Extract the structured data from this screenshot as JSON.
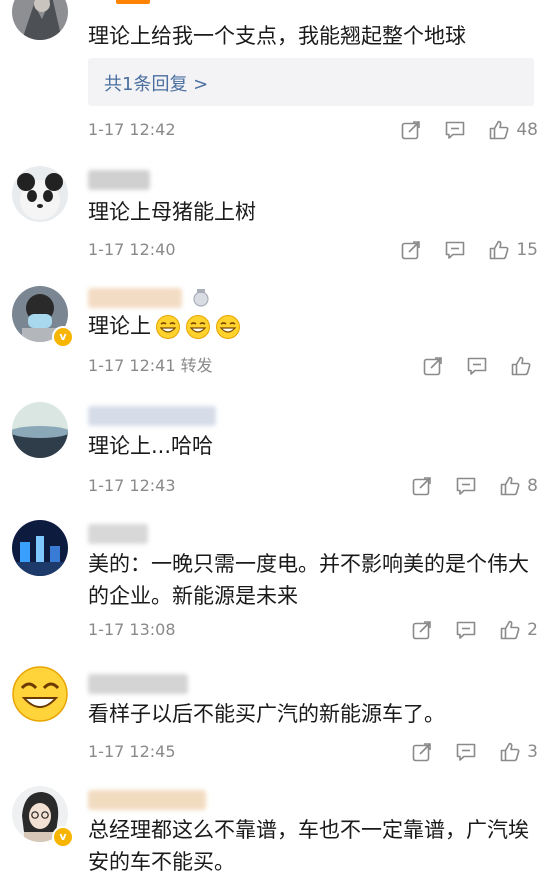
{
  "comments": [
    {
      "text": "理论上给我一个支点，我能翘起整个地球",
      "reply_link": "共1条回复 >",
      "meta": "1-17 12:42",
      "likes": "48",
      "name_blur_color": "#ccd4e6"
    },
    {
      "text": "理论上母猪能上树",
      "meta": "1-17 12:40",
      "likes": "15",
      "name_blur_color": "#d0d0d0"
    },
    {
      "text": "理论上",
      "meta": "1-17 12:41 转发",
      "likes": "",
      "name_blur_color": "#f3dcc4"
    },
    {
      "text": "理论上...哈哈",
      "meta": "1-17 12:43",
      "likes": "8",
      "name_blur_color": "#d6dde8"
    },
    {
      "text": "美的：一晚只需一度电。并不影响美的是个伟大的企业。新能源是未来",
      "meta": "1-17 13:08",
      "likes": "2",
      "name_blur_color": "#d8d8d8"
    },
    {
      "text": "看样子以后不能买广汽的新能源车了。",
      "meta": "1-17 12:45",
      "likes": "3",
      "name_blur_color": "#d4d4d4"
    },
    {
      "text": "总经理都这么不靠谱，车也不一定靠谱，广汽埃安的车不能买。",
      "meta": "",
      "likes": "",
      "name_blur_color": "#f2dcc0"
    }
  ],
  "colors": {
    "accent": "#ff8200",
    "link": "#4a6fa0",
    "meta": "#8a8a8a",
    "vip": "#f7b500"
  },
  "icons": [
    "share-icon",
    "comment-icon",
    "like-icon",
    "verified-badge",
    "grin-emoji"
  ]
}
